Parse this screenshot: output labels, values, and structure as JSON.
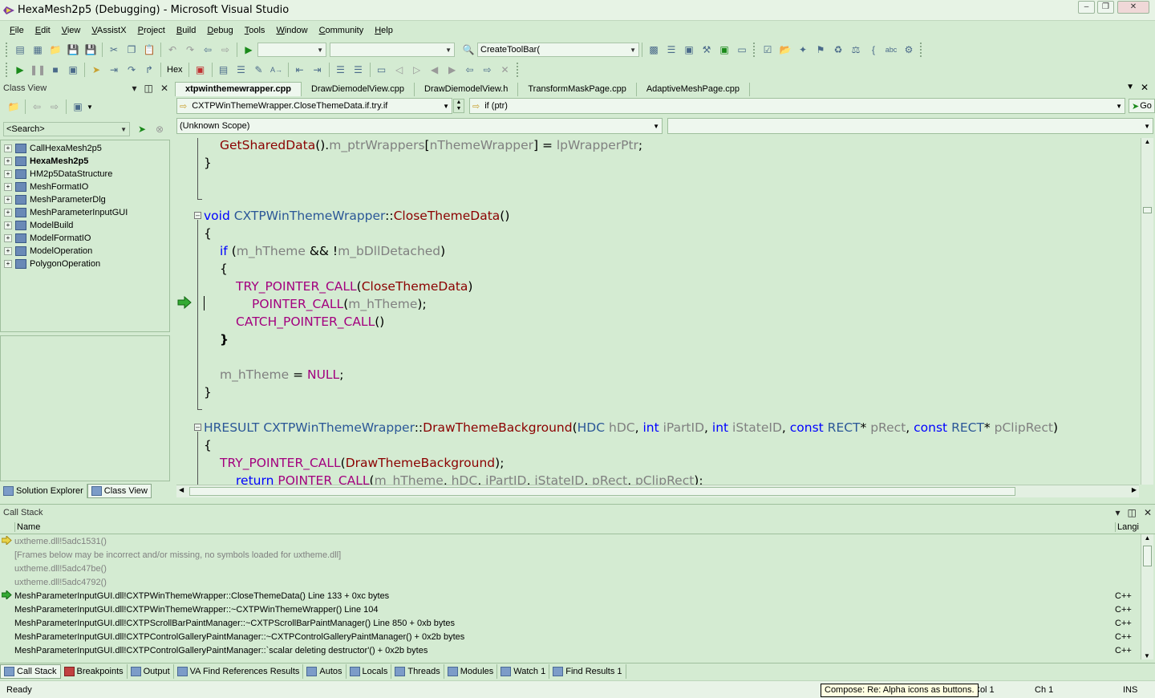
{
  "window": {
    "title": "HexaMesh2p5 (Debugging) - Microsoft Visual Studio"
  },
  "menu": [
    "File",
    "Edit",
    "View",
    "VAssistX",
    "Project",
    "Build",
    "Debug",
    "Tools",
    "Window",
    "Community",
    "Help"
  ],
  "toolbar": {
    "find_combo_value": "CreateToolBar(",
    "hex_label": "Hex"
  },
  "class_view": {
    "title": "Class View",
    "search_placeholder": "<Search>",
    "items": [
      {
        "label": "CallHexaMesh2p5",
        "bold": false,
        "selected": true
      },
      {
        "label": "HexaMesh2p5",
        "bold": true,
        "selected": false
      },
      {
        "label": "HM2p5DataStructure",
        "bold": false,
        "selected": false
      },
      {
        "label": "MeshFormatIO",
        "bold": false,
        "selected": false
      },
      {
        "label": "MeshParameterDlg",
        "bold": false,
        "selected": false
      },
      {
        "label": "MeshParameterInputGUI",
        "bold": false,
        "selected": false
      },
      {
        "label": "ModelBuild",
        "bold": false,
        "selected": false
      },
      {
        "label": "ModelFormatIO",
        "bold": false,
        "selected": false
      },
      {
        "label": "ModelOperation",
        "bold": false,
        "selected": false
      },
      {
        "label": "PolygonOperation",
        "bold": false,
        "selected": false
      }
    ],
    "tabs": [
      "Solution Explorer",
      "Class View"
    ]
  },
  "editor": {
    "tabs": [
      "xtpwinthemewrapper.cpp",
      "DrawDiemodelView.cpp",
      "DrawDiemodelView.h",
      "TransformMaskPage.cpp",
      "AdaptiveMeshPage.cpp"
    ],
    "active_tab": "xtpwinthemewrapper.cpp",
    "nav_left": "CXTPWinThemeWrapper.CloseThemeData.if.try.if",
    "nav_right": "if (ptr)",
    "go_label": "Go",
    "scope_left": "(Unknown Scope)",
    "scope_right": ""
  },
  "call_stack": {
    "title": "Call Stack",
    "columns": {
      "name": "Name",
      "lang": "Langi"
    },
    "rows": [
      {
        "name": "uxtheme.dll!5adc1531()",
        "lang": "",
        "marker": "current",
        "dim": true
      },
      {
        "name": "[Frames below may be incorrect and/or missing, no symbols loaded for uxtheme.dll]",
        "lang": "",
        "marker": "",
        "dim": true
      },
      {
        "name": "uxtheme.dll!5adc47be()",
        "lang": "",
        "marker": "",
        "dim": true
      },
      {
        "name": "uxtheme.dll!5adc4792()",
        "lang": "",
        "marker": "",
        "dim": true
      },
      {
        "name": "MeshParameterInputGUI.dll!CXTPWinThemeWrapper::CloseThemeData()  Line 133 + 0xc bytes",
        "lang": "C++",
        "marker": "return",
        "dim": false
      },
      {
        "name": "MeshParameterInputGUI.dll!CXTPWinThemeWrapper::~CXTPWinThemeWrapper()  Line 104",
        "lang": "C++",
        "marker": "",
        "dim": false
      },
      {
        "name": "MeshParameterInputGUI.dll!CXTPScrollBarPaintManager::~CXTPScrollBarPaintManager()  Line 850 + 0xb bytes",
        "lang": "C++",
        "marker": "",
        "dim": false
      },
      {
        "name": "MeshParameterInputGUI.dll!CXTPControlGalleryPaintManager::~CXTPControlGalleryPaintManager()  + 0x2b bytes",
        "lang": "C++",
        "marker": "",
        "dim": false
      },
      {
        "name": "MeshParameterInputGUI.dll!CXTPControlGalleryPaintManager::`scalar deleting destructor'()  + 0x2b bytes",
        "lang": "C++",
        "marker": "",
        "dim": false
      }
    ]
  },
  "bottom_tabs": [
    "Call Stack",
    "Breakpoints",
    "Output",
    "VA Find References Results",
    "Autos",
    "Locals",
    "Threads",
    "Modules",
    "Watch 1",
    "Find Results 1"
  ],
  "status": {
    "ready": "Ready",
    "tooltip": "Compose: Re: Alpha icons as buttons.",
    "col": "Col 1",
    "ch": "Ch 1",
    "ins": "INS"
  },
  "colors": {
    "background": "#d4ebd2",
    "keyword": "#0000ff",
    "function": "#8b0000",
    "macro": "#a3007f"
  }
}
